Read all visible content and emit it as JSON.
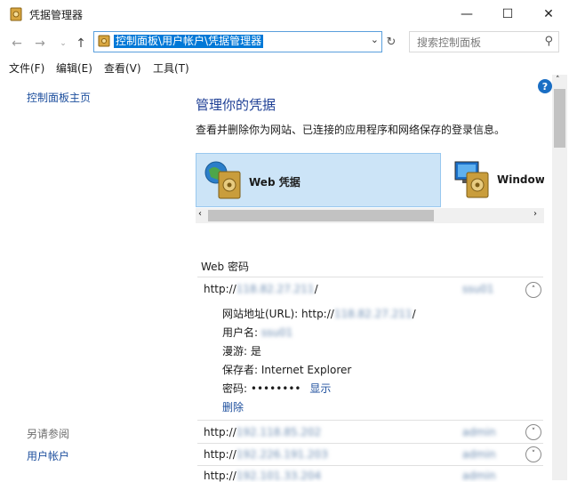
{
  "window": {
    "title": "凭据管理器",
    "minimize": "—",
    "maximize": "☐",
    "close": "✕"
  },
  "address": {
    "path": "控制面板\\用户帐户\\凭据管理器",
    "search_placeholder": "搜索控制面板"
  },
  "menu": [
    "文件(F)",
    "编辑(E)",
    "查看(V)",
    "工具(T)"
  ],
  "left": {
    "home": "控制面板主页",
    "see_also": "另请参阅",
    "user_accounts": "用户帐户"
  },
  "main": {
    "heading": "管理你的凭据",
    "subtitle": "查看并删除你为网站、已连接的应用程序和网络保存的登录信息。",
    "tabs": [
      {
        "label": "Web 凭据",
        "selected": true
      },
      {
        "label": "Windows",
        "selected": false
      }
    ],
    "section_title": "Web 密码",
    "expanded": {
      "url_prefix": "http://",
      "url_blurred": "118.82.27.211",
      "url_suffix": "/",
      "user_blurred": "ssu01",
      "fields": {
        "site_label": "网站地址(URL):",
        "site_value_prefix": "http://",
        "site_value_blurred": "118.82.27.211",
        "site_value_suffix": "/",
        "username_label": "用户名:",
        "username_blurred": "ssu01",
        "roaming_label": "漫游:",
        "roaming_value": "是",
        "saved_by_label": "保存者:",
        "saved_by_value": "Internet Explorer",
        "password_label": "密码:",
        "password_dots": "••••••••",
        "show": "显示",
        "delete": "删除"
      }
    },
    "collapsed": [
      {
        "prefix": "http://",
        "blurred": "192.118.85.202",
        "user_blurred": "admin"
      },
      {
        "prefix": "http://",
        "blurred": "192.226.191.203",
        "user_blurred": "admin"
      },
      {
        "prefix": "http://",
        "blurred": "192.101.33.204",
        "user_blurred": "admin"
      }
    ]
  }
}
